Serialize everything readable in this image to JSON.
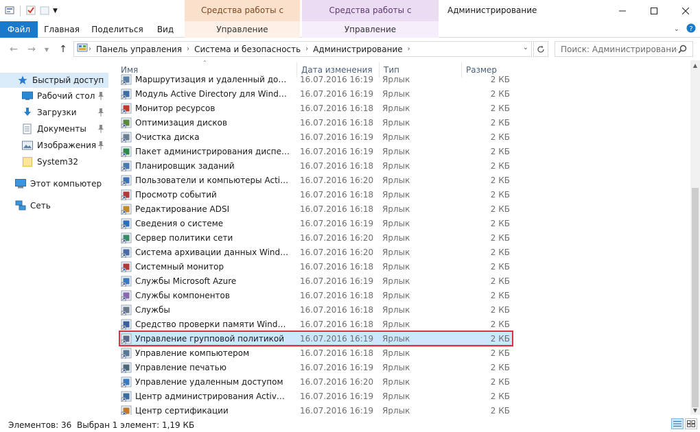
{
  "titlebar": {
    "context_tab_shortcut": "Средства работы с ярлыками",
    "context_tab_app": "Средства работы с приложениями",
    "window_title": "Администрирование"
  },
  "ribbon": {
    "tabs": {
      "file": "Файл",
      "home": "Главная",
      "share": "Поделиться",
      "view": "Вид",
      "manage_shortcut": "Управление",
      "manage_app": "Управление"
    }
  },
  "address": {
    "crumbs": [
      "Панель управления",
      "Система и безопасность",
      "Администрирование"
    ],
    "search_placeholder": "Поиск: Администрирование"
  },
  "navpane": {
    "items": [
      {
        "label": "Быстрый доступ",
        "icon": "star-icon"
      },
      {
        "label": "Рабочий стол",
        "icon": "desktop-icon",
        "pinned": true
      },
      {
        "label": "Загрузки",
        "icon": "download-icon",
        "pinned": true
      },
      {
        "label": "Документы",
        "icon": "documents-icon",
        "pinned": true
      },
      {
        "label": "Изображения",
        "icon": "pictures-icon",
        "pinned": true
      },
      {
        "label": "System32",
        "icon": "folder-icon"
      },
      {
        "label": "Этот компьютер",
        "icon": "computer-icon"
      },
      {
        "label": "Сеть",
        "icon": "network-icon"
      }
    ]
  },
  "filelist": {
    "columns": {
      "name": "Имя",
      "date": "Дата изменения",
      "type": "Тип",
      "size": "Размер"
    },
    "rows": [
      {
        "name": "Маршрутизация и удаленный доступ",
        "date": "16.07.2016 16:19",
        "type": "Ярлык",
        "size": "2 КБ"
      },
      {
        "name": "Модуль Active Directory для Windows P...",
        "date": "16.07.2016 16:19",
        "type": "Ярлык",
        "size": "2 КБ"
      },
      {
        "name": "Монитор ресурсов",
        "date": "16.07.2016 16:18",
        "type": "Ярлык",
        "size": "2 КБ"
      },
      {
        "name": "Оптимизация дисков",
        "date": "16.07.2016 16:18",
        "type": "Ярлык",
        "size": "2 КБ"
      },
      {
        "name": "Очистка диска",
        "date": "16.07.2016 16:19",
        "type": "Ярлык",
        "size": "2 КБ"
      },
      {
        "name": "Пакет администрирования диспетчера ...",
        "date": "16.07.2016 16:19",
        "type": "Ярлык",
        "size": "2 КБ"
      },
      {
        "name": "Планировщик заданий",
        "date": "16.07.2016 16:18",
        "type": "Ярлык",
        "size": "2 КБ"
      },
      {
        "name": "Пользователи и компьютеры Active Dir...",
        "date": "16.07.2016 16:20",
        "type": "Ярлык",
        "size": "2 КБ"
      },
      {
        "name": "Просмотр событий",
        "date": "16.07.2016 16:18",
        "type": "Ярлык",
        "size": "2 КБ"
      },
      {
        "name": "Редактирование ADSI",
        "date": "16.07.2016 16:18",
        "type": "Ярлык",
        "size": "2 КБ"
      },
      {
        "name": "Сведения о системе",
        "date": "16.07.2016 16:19",
        "type": "Ярлык",
        "size": "2 КБ"
      },
      {
        "name": "Сервер политики сети",
        "date": "16.07.2016 16:20",
        "type": "Ярлык",
        "size": "2 КБ"
      },
      {
        "name": "Система архивации данных Windows S...",
        "date": "16.07.2016 16:20",
        "type": "Ярлык",
        "size": "2 КБ"
      },
      {
        "name": "Системный монитор",
        "date": "16.07.2016 16:18",
        "type": "Ярлык",
        "size": "2 КБ"
      },
      {
        "name": "Службы Microsoft Azure",
        "date": "16.07.2016 16:19",
        "type": "Ярлык",
        "size": "2 КБ"
      },
      {
        "name": "Службы компонентов",
        "date": "16.07.2016 16:18",
        "type": "Ярлык",
        "size": "2 КБ"
      },
      {
        "name": "Службы",
        "date": "16.07.2016 16:18",
        "type": "Ярлык",
        "size": "2 КБ"
      },
      {
        "name": "Средство проверки памяти Windows",
        "date": "16.07.2016 16:18",
        "type": "Ярлык",
        "size": "2 КБ"
      },
      {
        "name": "Управление групповой политикой",
        "date": "16.07.2016 16:19",
        "type": "Ярлык",
        "size": "2 КБ",
        "selected": true
      },
      {
        "name": "Управление компьютером",
        "date": "16.07.2016 16:18",
        "type": "Ярлык",
        "size": "2 КБ"
      },
      {
        "name": "Управление печатью",
        "date": "16.07.2016 16:19",
        "type": "Ярлык",
        "size": "2 КБ"
      },
      {
        "name": "Управление удаленным доступом",
        "date": "16.07.2016 16:20",
        "type": "Ярлык",
        "size": "2 КБ"
      },
      {
        "name": "Центр администрирования Active Direc...",
        "date": "16.07.2016 16:19",
        "type": "Ярлык",
        "size": "2 КБ"
      },
      {
        "name": "Центр сертификации",
        "date": "16.07.2016 16:19",
        "type": "Ярлык",
        "size": "2 КБ"
      }
    ]
  },
  "status": {
    "count": "Элементов: 36",
    "selection": "Выбран 1 элемент: 1,19 КБ"
  },
  "colors": {
    "accent": "#1979ca",
    "selection_bg": "#cce8ff",
    "highlight_border": "#d9333f",
    "shortcut_tab": "#fbe1cc",
    "app_tab": "#ecdcf3"
  }
}
